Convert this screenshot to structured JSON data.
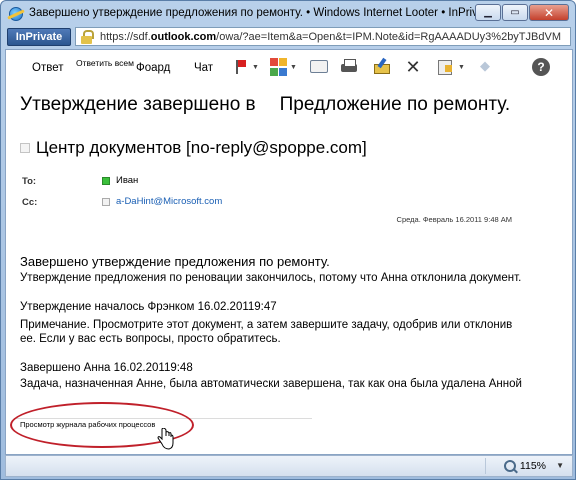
{
  "window": {
    "title": "Завершено утверждение предложения по ремонту. • Windows Internet Looter • InPrivatel"
  },
  "addressbar": {
    "inprivate_label": "InPrivate",
    "url_prefix": "https://sdf.",
    "url_domain": "outlook.com",
    "url_rest": "/owa/?ae=Item&a=Open&t=IPM.Note&id=RgAAAADUy3%2byTJBdVM"
  },
  "toolbar": {
    "reply": "Ответ",
    "reply_all": "Ответить всем",
    "forward": "Фоард",
    "chat": "Чат"
  },
  "message": {
    "subject_part1": "Утверждение завершено в",
    "subject_part2": "Предложение по ремонту.",
    "sender": "Центр документов [no-reply@spoppe.com]",
    "to_label": "To:",
    "to_name": "Иван",
    "cc_label": "Cc:",
    "cc_name": "a-DaHint@Microsoft.com",
    "sent": "Среда. Февраль 16.2011 9:48 AM",
    "body": {
      "heading": "Завершено утверждение предложения по ремонту.",
      "line1": "Утверждение предложения по реновации закончилось, потому что Анна отклонила документ.",
      "line2": "Утверждение началось Фрэнком 16.02.20119:47",
      "line3": "Примечание. Просмотрите этот документ, а затем завершите задачу, одобрив или отклонив",
      "line4": "ее. Если у вас есть вопросы, просто обратитесь.",
      "line5": "Завершено Анна 16.02.20119:48",
      "line6": "Задача, назначенная Анне, была автоматически завершена, так как она была удалена Анной"
    },
    "history_link": "Просмотр журнала рабочих процессов"
  },
  "statusbar": {
    "zoom": "115%"
  },
  "colors": {
    "highlight": "#c0202a",
    "link": "#1a5fb4",
    "presence_online": "#3bbf3b"
  }
}
